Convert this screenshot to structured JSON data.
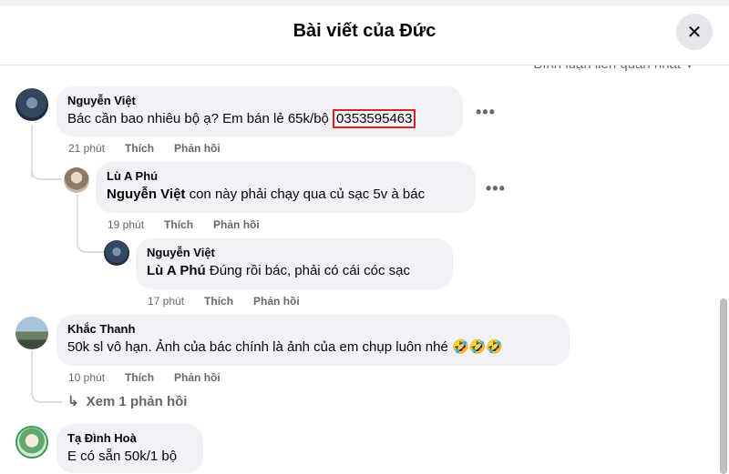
{
  "header": {
    "title": "Bài viết của Đức",
    "sort_label": "Bình luận liên quan nhất"
  },
  "icons": {
    "close": "close-icon",
    "more": "more-options-icon",
    "reply_arrow": "reply-arrow-icon"
  },
  "comments": [
    {
      "author": "Nguyễn Việt",
      "text": "Bác cần bao nhiêu bộ ạ? Em bán lẻ 65k/bộ",
      "phone": "0353595463",
      "time": "21 phút",
      "like": "Thích",
      "reply": "Phản hồi",
      "replies": [
        {
          "author": "Lù A Phú",
          "mention": "Nguyễn Việt",
          "text": "con này phải chạy qua củ sạc 5v à bác",
          "time": "19 phút",
          "like": "Thích",
          "reply": "Phản hồi"
        },
        {
          "author": "Nguyễn Việt",
          "mention": "Lù A Phú",
          "text": "Đúng rồi bác, phải có cái cóc sạc",
          "time": "17 phút",
          "like": "Thích",
          "reply": "Phản hồi"
        }
      ]
    },
    {
      "author": "Khắc Thanh",
      "text": "50k sl vô hạn. Ảnh của bác chính là ảnh của em chụp luôn nhé",
      "emojis": "🤣🤣🤣",
      "time": "10 phút",
      "like": "Thích",
      "reply": "Phản hồi",
      "more_replies": "Xem 1 phản hồi"
    },
    {
      "author": "Tạ Đình Hoà",
      "text": "E có sẵn 50k/1 bộ"
    }
  ]
}
